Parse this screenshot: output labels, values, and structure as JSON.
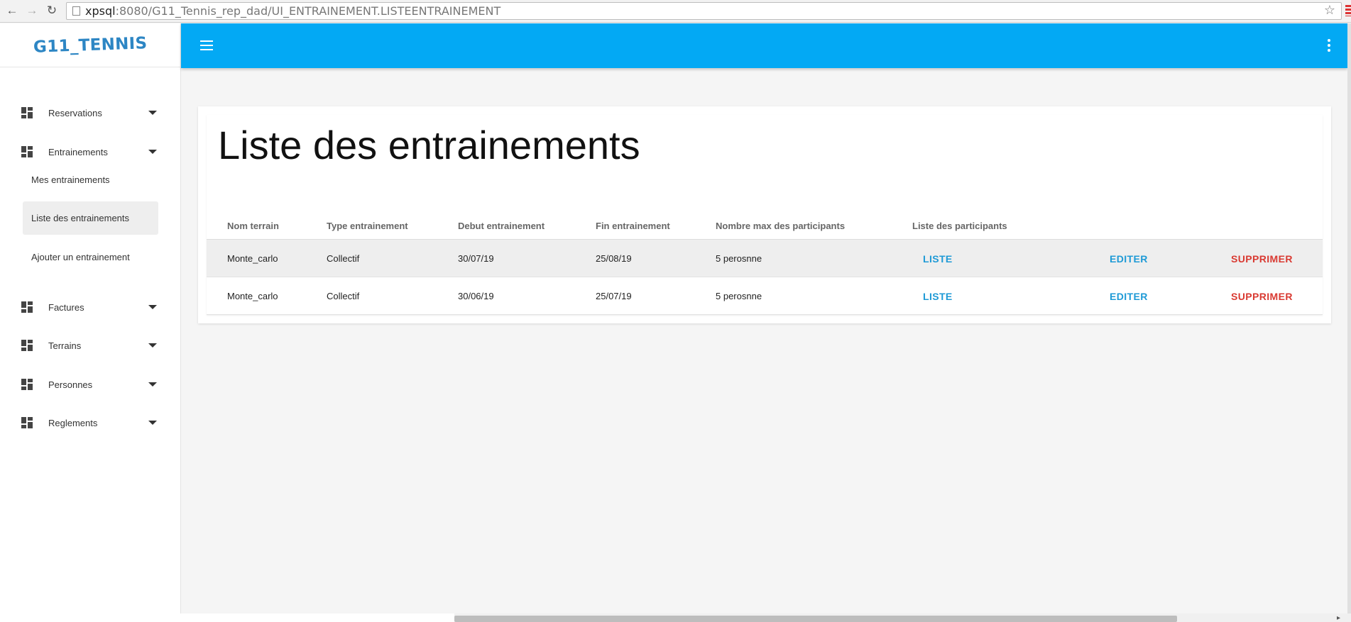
{
  "browser": {
    "url_host": "xpsql",
    "url_rest": ":8080/G11_Tennis_rep_dad/UI_ENTRAINEMENT.LISTEENTRAINEMENT"
  },
  "sidebar": {
    "logo": "G11_TENNIS",
    "groups": [
      {
        "label": "Reservations"
      },
      {
        "label": "Entrainements"
      },
      {
        "label": "Factures"
      },
      {
        "label": "Terrains"
      },
      {
        "label": "Personnes"
      },
      {
        "label": "Reglements"
      }
    ],
    "subitems": [
      {
        "label": "Mes entrainements",
        "active": false
      },
      {
        "label": "Liste des entrainements",
        "active": true
      },
      {
        "label": "Ajouter un entrainement",
        "active": false
      }
    ]
  },
  "appbar": {
    "color": "#03a9f4"
  },
  "main": {
    "title": "Liste des entrainements",
    "columns": [
      "Nom terrain",
      "Type entrainement",
      "Debut entrainement",
      "Fin entrainement",
      "Nombre max des participants",
      "Liste des participants"
    ],
    "rows": [
      {
        "terrain": "Monte_carlo",
        "type": "Collectif",
        "debut": "30/07/19",
        "fin": "25/08/19",
        "max": "5 perosnne",
        "liste": "LISTE",
        "editer": "EDITER",
        "supprimer": "SUPPRIMER"
      },
      {
        "terrain": "Monte_carlo",
        "type": "Collectif",
        "debut": "30/06/19",
        "fin": "25/07/19",
        "max": "5 perosnne",
        "liste": "LISTE",
        "editer": "EDITER",
        "supprimer": "SUPPRIMER"
      }
    ],
    "action_colors": {
      "liste": "#1e9ad6",
      "editer": "#1e9ad6",
      "supprimer": "#d93a32"
    }
  }
}
